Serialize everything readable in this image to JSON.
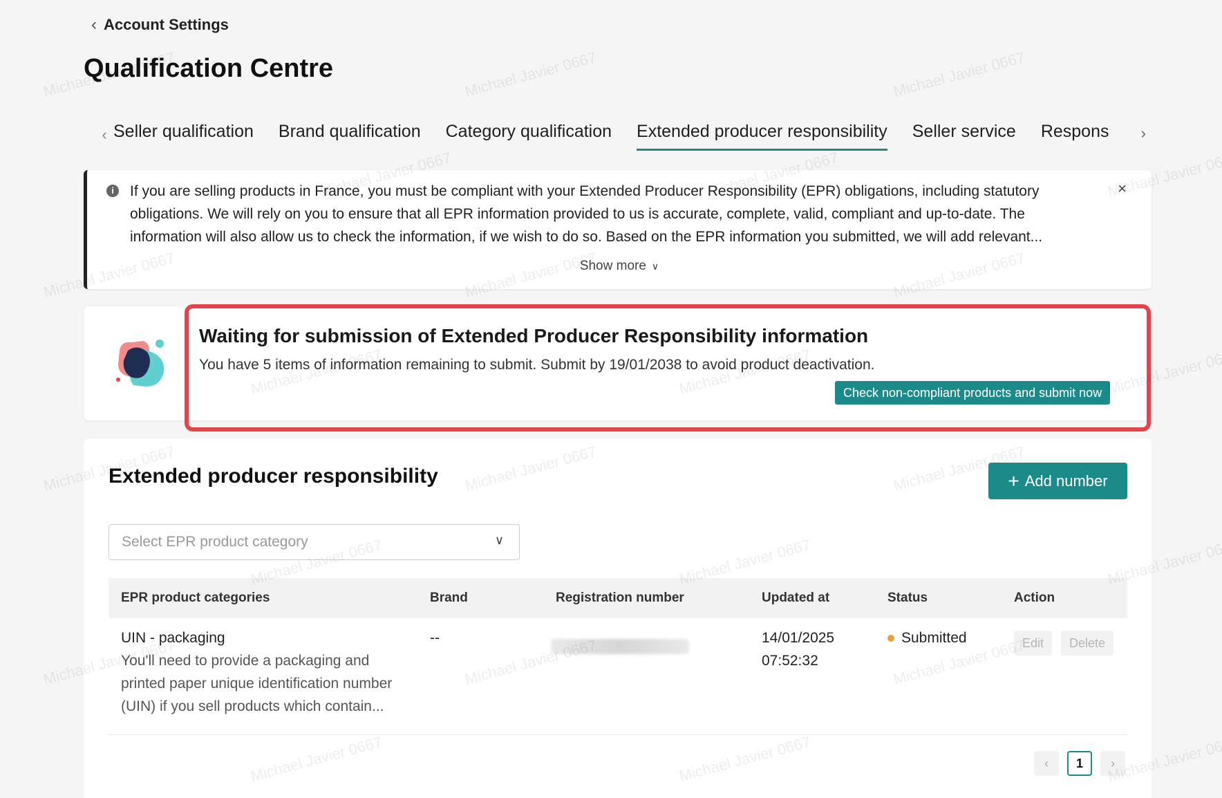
{
  "header": {
    "back_label": "Account Settings",
    "page_title": "Qualification Centre"
  },
  "tabs": [
    {
      "label": "Seller qualification",
      "active": false
    },
    {
      "label": "Brand qualification",
      "active": false
    },
    {
      "label": "Category qualification",
      "active": false
    },
    {
      "label": "Extended producer responsibility",
      "active": true
    },
    {
      "label": "Seller service",
      "active": false
    },
    {
      "label": "Respons",
      "active": false
    }
  ],
  "notice": {
    "text": "If you are selling products in France, you must be compliant with your Extended Producer Responsibility (EPR) obligations, including statutory obligations. We will rely on you to ensure that all EPR information provided to us is accurate, complete, valid, compliant and up-to-date. The information will also allow us to check the information, if we wish to do so. Based on the EPR information you submitted, we will add relevant...",
    "show_more": "Show more"
  },
  "waiting_card": {
    "title": "Waiting for submission of Extended Producer Responsibility information",
    "subtitle": "You have 5 items of information remaining to submit. Submit by 19/01/2038 to avoid product deactivation.",
    "cta": "Check non-compliant products and submit now"
  },
  "epr_section": {
    "title": "Extended producer responsibility",
    "add_button": "Add number",
    "select_placeholder": "Select EPR product category",
    "columns": {
      "category": "EPR product categories",
      "brand": "Brand",
      "registration": "Registration number",
      "updated": "Updated at",
      "status": "Status",
      "action": "Action"
    },
    "rows": [
      {
        "category_name": "UIN - packaging",
        "category_desc": "You'll need to provide a packaging and printed paper unique identification number (UIN) if you sell products which contain...",
        "brand": "--",
        "updated_date": "14/01/2025",
        "updated_time": "07:52:32",
        "status": "Submitted",
        "edit_label": "Edit",
        "delete_label": "Delete"
      }
    ],
    "pagination": {
      "current_page": "1"
    }
  },
  "watermark": "Michael Javier 0667",
  "colors": {
    "accent": "#1d8a8a",
    "highlight": "#e5424a",
    "status_submitted": "#e6a23c"
  }
}
